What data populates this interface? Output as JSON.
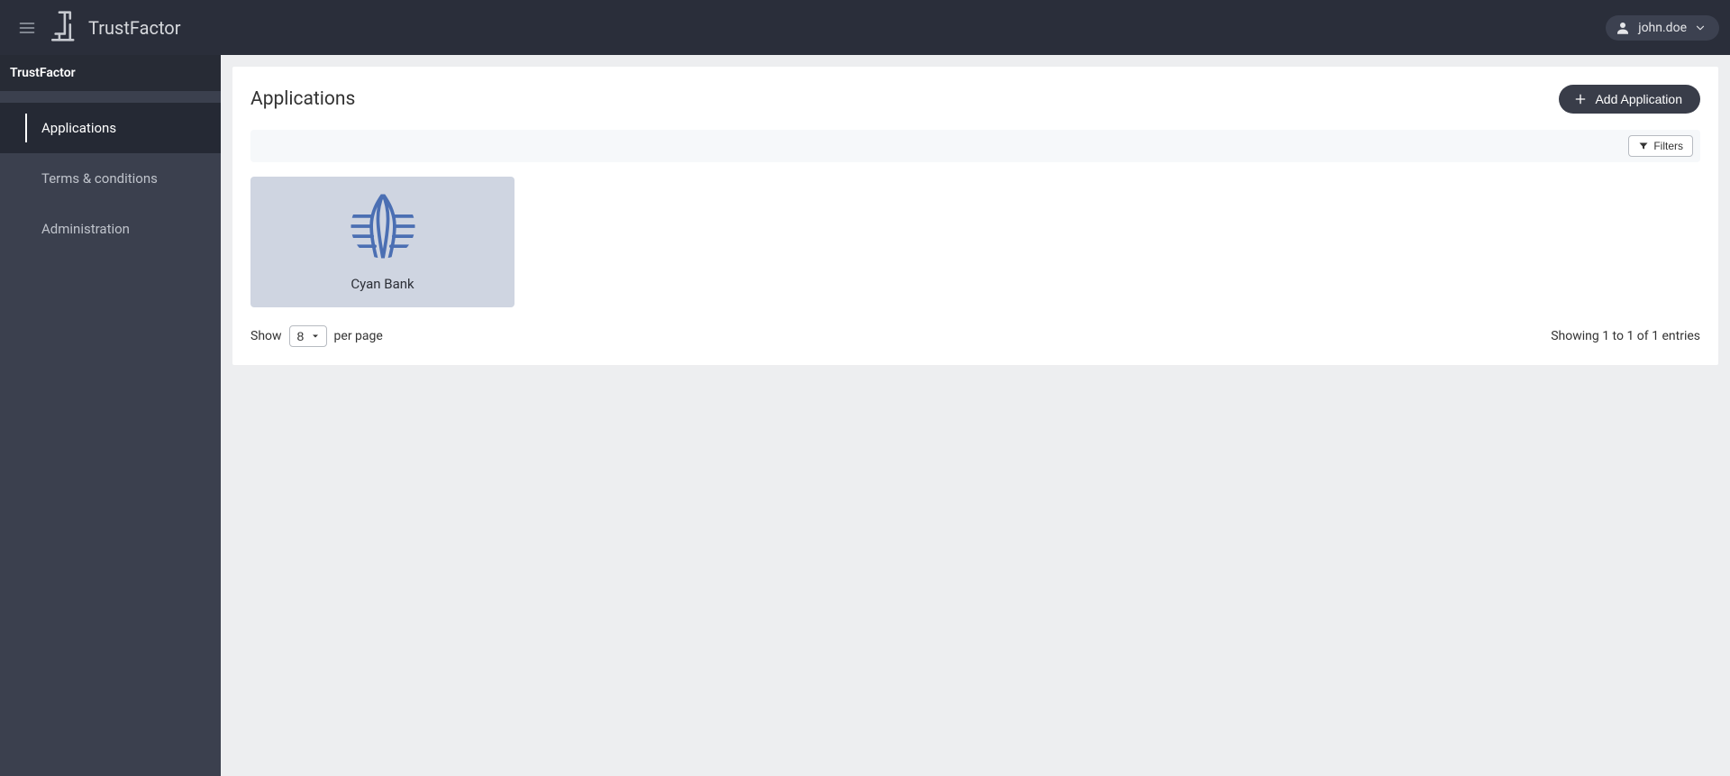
{
  "header": {
    "brand": "TrustFactor",
    "user": "john.doe"
  },
  "sidebar": {
    "title": "TrustFactor",
    "items": [
      {
        "label": "Applications",
        "active": true
      },
      {
        "label": "Terms & conditions",
        "active": false
      },
      {
        "label": "Administration",
        "active": false
      }
    ]
  },
  "page": {
    "title": "Applications",
    "add_button": "Add Application",
    "filters_button": "Filters"
  },
  "applications": [
    {
      "name": "Cyan Bank"
    }
  ],
  "pagination": {
    "show_label": "Show",
    "per_page_label": "per page",
    "page_size": "8",
    "summary": "Showing 1 to 1 of 1 entries"
  }
}
